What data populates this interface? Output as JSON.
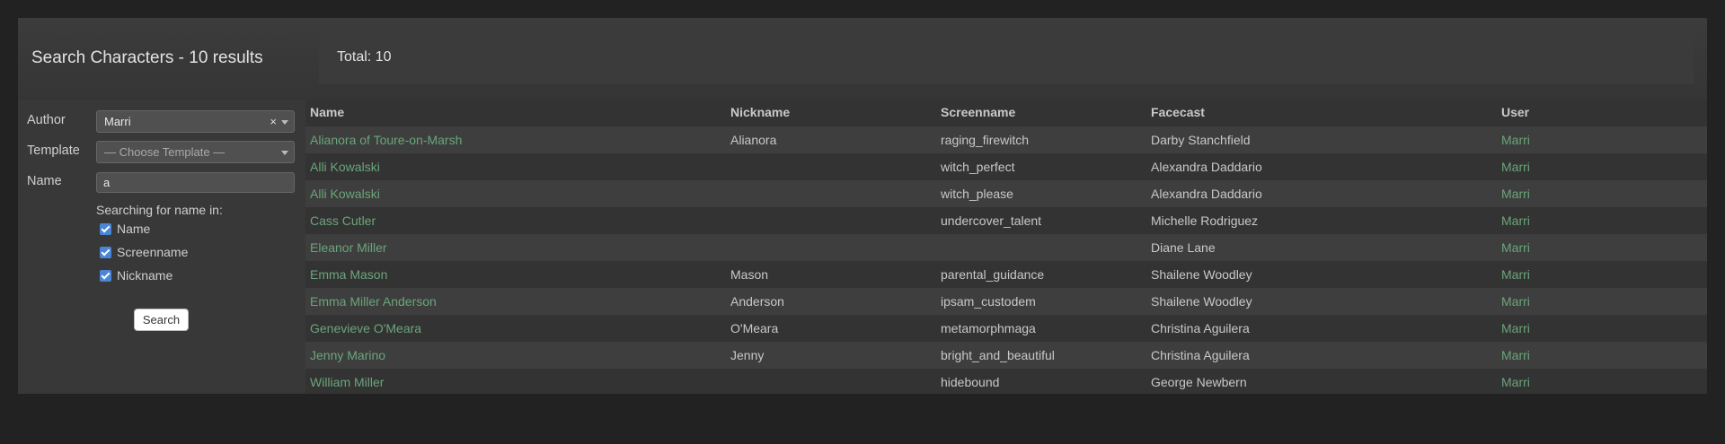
{
  "header": {
    "title": "Search Characters - 10 results",
    "total": "Total: 10"
  },
  "sidebar": {
    "author_label": "Author",
    "author_value": "Marri",
    "author_clear": "×",
    "template_label": "Template",
    "template_placeholder": "— Choose Template —",
    "name_label": "Name",
    "name_value": "a",
    "search_in_label": "Searching for name in:",
    "checkboxes": [
      {
        "label": "Name",
        "checked": true
      },
      {
        "label": "Screenname",
        "checked": true
      },
      {
        "label": "Nickname",
        "checked": true
      }
    ],
    "search_button": "Search"
  },
  "table": {
    "columns": [
      "Name",
      "Nickname",
      "Screenname",
      "Facecast",
      "User"
    ],
    "rows": [
      [
        "Alianora of Toure-on-Marsh",
        "Alianora",
        "raging_firewitch",
        "Darby Stanchfield",
        "Marri"
      ],
      [
        "Alli Kowalski",
        "",
        "witch_perfect",
        "Alexandra Daddario",
        "Marri"
      ],
      [
        "Alli Kowalski",
        "",
        "witch_please",
        "Alexandra Daddario",
        "Marri"
      ],
      [
        "Cass Cutler",
        "",
        "undercover_talent",
        "Michelle Rodriguez",
        "Marri"
      ],
      [
        "Eleanor Miller",
        "",
        "",
        "Diane Lane",
        "Marri"
      ],
      [
        "Emma Mason",
        "Mason",
        "parental_guidance",
        "Shailene Woodley",
        "Marri"
      ],
      [
        "Emma Miller Anderson",
        "Anderson",
        "ipsam_custodem",
        "Shailene Woodley",
        "Marri"
      ],
      [
        "Genevieve O'Meara",
        "O'Meara",
        "metamorphmaga",
        "Christina Aguilera",
        "Marri"
      ],
      [
        "Jenny Marino",
        "Jenny",
        "bright_and_beautiful",
        "Christina Aguilera",
        "Marri"
      ],
      [
        "William Miller",
        "",
        "hidebound",
        "George Newbern",
        "Marri"
      ]
    ]
  }
}
